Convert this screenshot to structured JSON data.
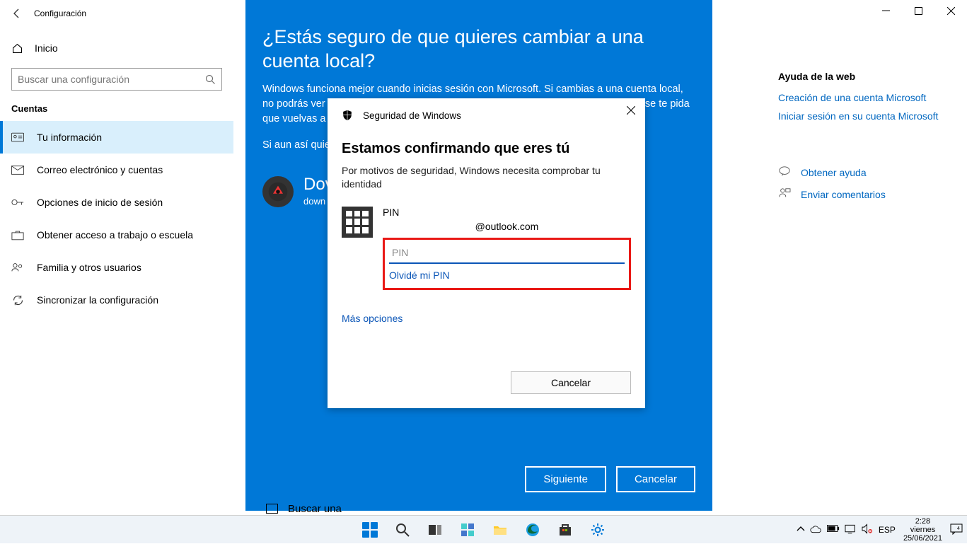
{
  "window": {
    "title": "Configuración"
  },
  "sidebar": {
    "home": "Inicio",
    "search_placeholder": "Buscar una configuración",
    "section": "Cuentas",
    "items": [
      "Tu información",
      "Correo electrónico y cuentas",
      "Opciones de inicio de sesión",
      "Obtener acceso a trabajo o escuela",
      "Familia y otros usuarios",
      "Sincronizar la configuración"
    ]
  },
  "right": {
    "heading": "Ayuda de la web",
    "links": [
      "Creación de una cuenta Microsoft",
      "Iniciar sesión en su cuenta Microsoft"
    ],
    "help": "Obtener ayuda",
    "feedback": "Enviar comentarios"
  },
  "blue": {
    "title": "¿Estás seguro de que quieres cambiar a una cuenta local?",
    "desc": "Windows funciona mejor cuando inicias sesión con Microsoft. Si cambias a una cuenta local, no podrás ver tu contenido personalizado en todos tus dispositivos y es posible que se te pida que vuelvas a iniciar sesión si quieres obtener acceso a la información de tu cuenta.",
    "if_line": "Si aun así quieres continuar, ve al paso siguiente para verificar tu identidad.",
    "user_name": "Dov",
    "user_sub": "down",
    "btn_next": "Siguiente",
    "btn_cancel": "Cancelar"
  },
  "dialog": {
    "header": "Seguridad de Windows",
    "h2": "Estamos confirmando que eres tú",
    "sub": "Por motivos de seguridad, Windows necesita comprobar tu identidad",
    "pin_label": "PIN",
    "email": "@outlook.com",
    "pin_placeholder": "PIN",
    "forgot": "Olvidé mi PIN",
    "more": "Más opciones",
    "cancel": "Cancelar"
  },
  "bottom_trunc": "Buscar una",
  "tray": {
    "lang": "ESP",
    "time": "2:28",
    "day": "viernes",
    "date": "25/06/2021"
  }
}
